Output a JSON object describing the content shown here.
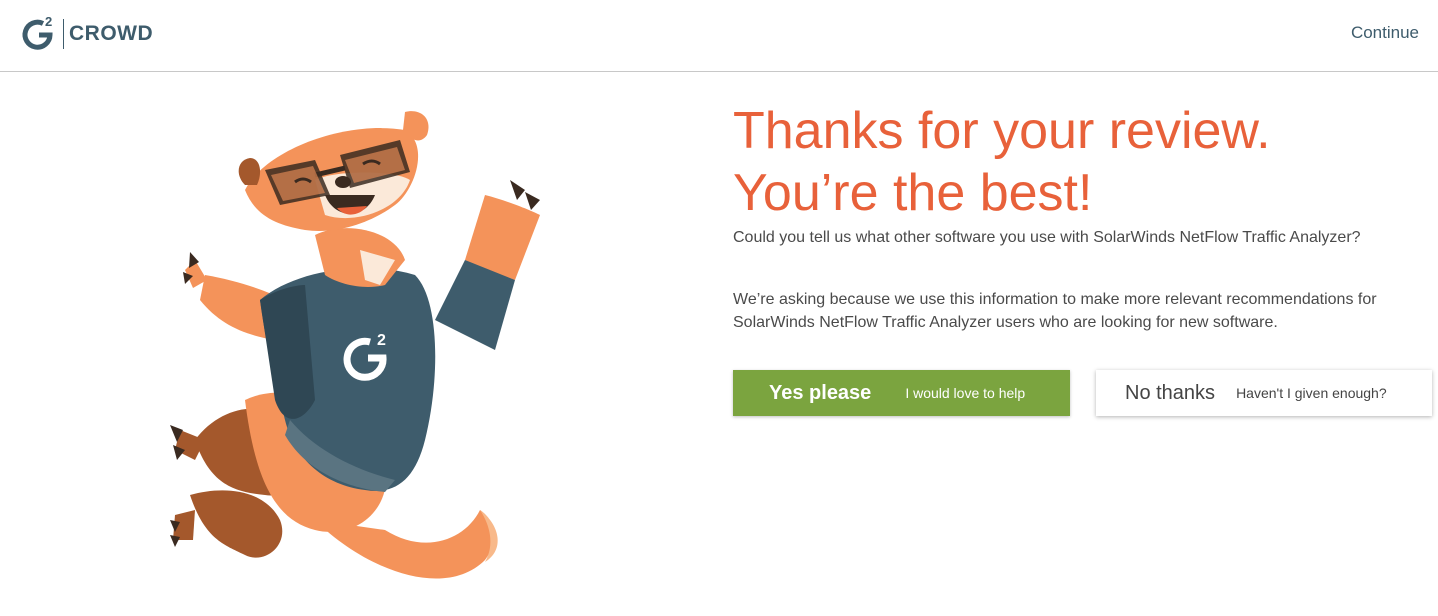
{
  "header": {
    "logo_superscript": "2",
    "logo_text": "CROWD",
    "continue_label": "Continue"
  },
  "main": {
    "headline_line1": "Thanks for your review.",
    "headline_line2": "You’re the best!",
    "question": "Could you tell us what other software you use with SolarWinds NetFlow Traffic Analyzer?",
    "explanation": "We’re asking because we use this information to make more relevant recommendations for SolarWinds NetFlow Traffic Analyzer users who are looking for new software.",
    "yes_button": {
      "label": "Yes please",
      "sublabel": "I would love to help"
    },
    "no_button": {
      "label": "No thanks",
      "sublabel": "Haven't I given enough?"
    },
    "mascot": {
      "shirt_logo_superscript": "2"
    }
  },
  "colors": {
    "accent_orange": "#e8613a",
    "brand_slate": "#3e5c6c",
    "yes_green": "#7ba43f"
  },
  "icons": [
    "g2-crowd-logo-icon",
    "ferret-mascot-icon"
  ]
}
